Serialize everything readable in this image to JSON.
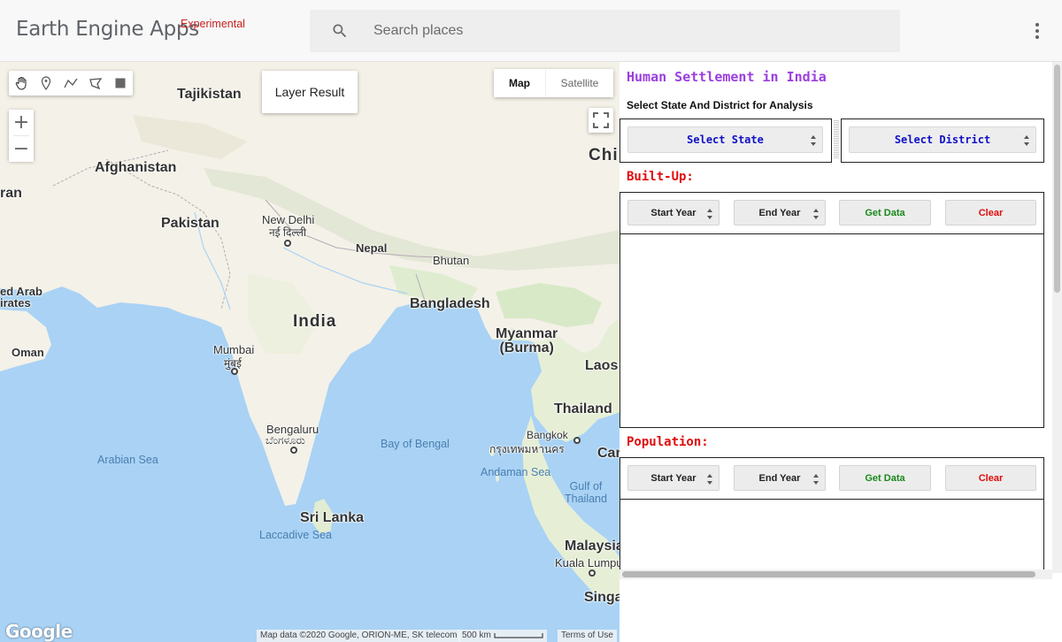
{
  "header": {
    "brand": "Earth Engine Apps",
    "brand_tag": "Experimental",
    "search_placeholder": "Search places"
  },
  "map": {
    "layer_button": "Layer Result",
    "map_type": {
      "map": "Map",
      "satellite": "Satellite"
    },
    "zoom_in": "+",
    "zoom_out": "−",
    "google_logo": "Google",
    "attribution": "Map data ©2020 Google, ORION-ME, SK telecom",
    "scale": "500 km",
    "terms": "Terms of Use",
    "labels": {
      "tajikistan": "Tajikistan",
      "afghanistan": "Afghanistan",
      "pakistan": "Pakistan",
      "new_delhi": "New Delhi",
      "new_delhi_hi": "नई दिल्ली",
      "nepal": "Nepal",
      "bhutan": "Bhutan",
      "china": "Chi",
      "iran": "ran",
      "uae": "ed Arab\nirates",
      "oman": "Oman",
      "india": "India",
      "bangladesh": "Bangladesh",
      "myanmar": "Myanmar\n(Burma)",
      "laos": "Laos",
      "mumbai": "Mumbai",
      "mumbai_mr": "मुंबई",
      "thailand": "Thailand",
      "bangkok": "Bangkok",
      "bangkok_th": "กรุงเทพมหานคร",
      "cambodia": "Car",
      "bengaluru": "Bengaluru",
      "bengaluru_kn": "ಬೆಂಗಳೂರು",
      "bay_of_bengal": "Bay of Bengal",
      "arabian_sea": "Arabian Sea",
      "andaman_sea": "Andaman Sea",
      "gulf_of_thailand": "Gulf of\nThailand",
      "sri_lanka": "Sri Lanka",
      "laccadive_sea": "Laccadive Sea",
      "malaysia": "Malaysia",
      "kuala_lumpur": "Kuala Lumpu",
      "singapore": "Singa"
    }
  },
  "panel": {
    "title": "Human Settlement in India",
    "subtitle": "Select State And District for Analysis",
    "select_state": "Select State",
    "select_district": "Select District",
    "builtup": {
      "label": "Built-Up:",
      "start_year": "Start Year",
      "end_year": "End Year",
      "get_data": "Get Data",
      "clear": "Clear"
    },
    "population": {
      "label": "Population:",
      "start_year": "Start Year",
      "end_year": "End Year",
      "get_data": "Get Data",
      "clear": "Clear"
    }
  },
  "colors": {
    "title": "#9b3ee0",
    "section": "#e00c0c",
    "select_text": "#1010c8",
    "get_data": "#1a8a1a",
    "ocean": "#a9d2f5",
    "land": "#f4f1e8"
  }
}
